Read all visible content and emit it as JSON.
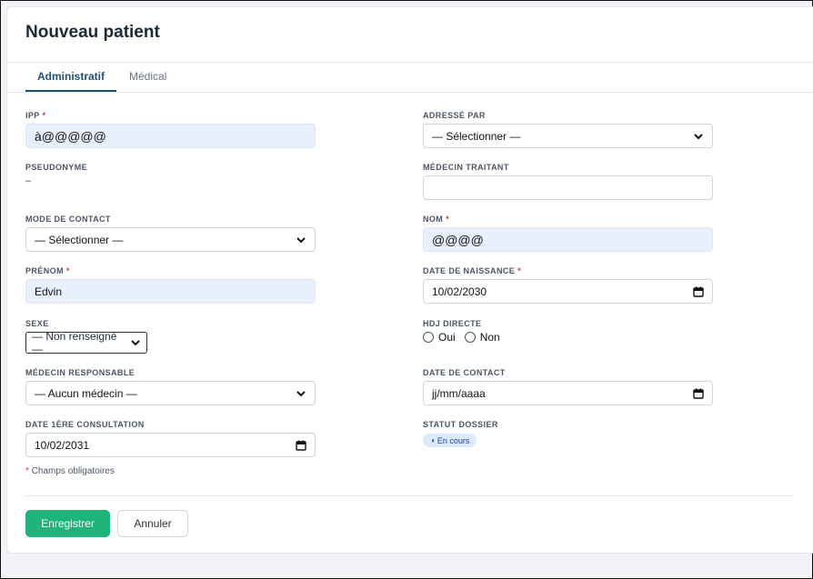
{
  "title": "Nouveau patient",
  "tabs": [
    {
      "label": "Administratif",
      "active": true
    },
    {
      "label": "Médical",
      "active": false
    }
  ],
  "required_mark": "*",
  "fields": {
    "ipp": {
      "label": "IPP",
      "value": "à@@@@@"
    },
    "adresse_par": {
      "label": "ADRESSÉ PAR",
      "value": "— Sélectionner —"
    },
    "pseudonyme": {
      "label": "PSEUDONYME",
      "value": "–"
    },
    "medecin_traitant": {
      "label": "MÉDECIN TRAITANT",
      "value": ""
    },
    "mode_contact": {
      "label": "MODE DE CONTACT",
      "value": "— Sélectionner —"
    },
    "nom": {
      "label": "NOM",
      "value": "@@@@"
    },
    "prenom": {
      "label": "PRÉNOM",
      "value": "Edvin"
    },
    "date_naissance": {
      "label": "DATE DE NAISSANCE",
      "value": "10/02/2030"
    },
    "sexe": {
      "label": "SEXE",
      "value": "— Non renseigné —"
    },
    "hdj_directe": {
      "label": "HDJ DIRECTE",
      "options": [
        "Oui",
        "Non"
      ]
    },
    "medecin_responsable": {
      "label": "MÉDECIN RESPONSABLE",
      "value": "— Aucun médecin —"
    },
    "date_contact": {
      "label": "DATE DE CONTACT",
      "value": "jj/mm/aaaa"
    },
    "date_1ere_consultation": {
      "label": "DATE 1ÈRE CONSULTATION",
      "value": "10/02/2031"
    },
    "statut_dossier": {
      "label": "STATUT DOSSIER",
      "value": "En cours",
      "icon": "half-circle-icon"
    }
  },
  "required_note": "Champs obligatoires",
  "buttons": {
    "save": "Enregistrer",
    "cancel": "Annuler"
  },
  "colors": {
    "primary": "#1fb57a",
    "accent": "#1f4f7a",
    "required": "#d9363e",
    "filled_bg": "#e8f0fe",
    "badge_bg": "#dbeafe"
  }
}
